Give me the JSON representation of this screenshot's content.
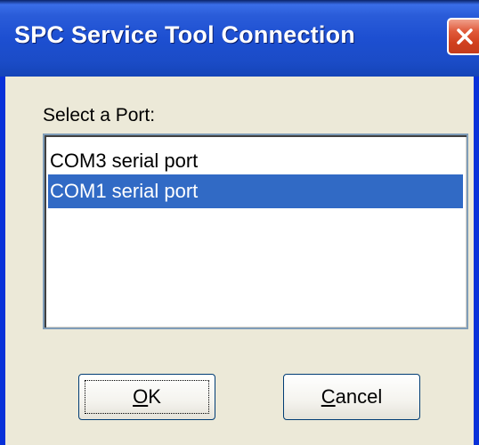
{
  "window": {
    "title": "SPC Service Tool Connection",
    "close_icon": "close-icon",
    "accent_color": "#316ac5",
    "titlebar_color": "#1d4fd1",
    "close_color": "#d0401e"
  },
  "dialog": {
    "label": "Select a Port:",
    "ports": [
      {
        "label": "COM3 serial port",
        "selected": false
      },
      {
        "label": "COM1 serial port",
        "selected": true
      }
    ]
  },
  "buttons": {
    "ok": {
      "mnemonic": "O",
      "rest": "K"
    },
    "cancel": {
      "mnemonic": "C",
      "rest": "ancel"
    }
  }
}
